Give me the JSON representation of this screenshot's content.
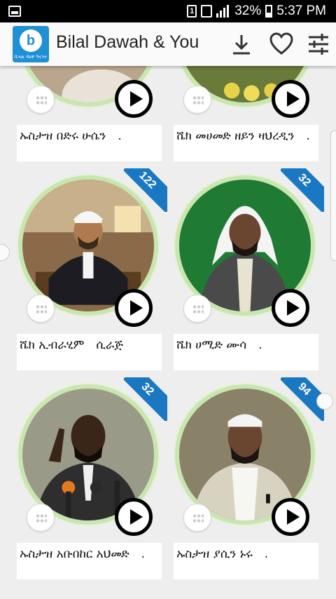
{
  "status_bar": {
    "sim_badge": "1",
    "battery": "32%",
    "time": "5:37 PM"
  },
  "app_bar": {
    "title": "Bilal Dawah & You",
    "logo_letter": "b",
    "logo_caption": "ቢላል ዳዕዋ ካናንተ",
    "icons": [
      "download-icon",
      "heart-icon",
      "filter-icon"
    ]
  },
  "colors": {
    "accent": "#1a78c2",
    "ring": "#c9e6b0",
    "logo_bg": "#1f8fd6"
  },
  "items": [
    {
      "name": "ኡስታዝ በድሩ ሁሴን　.",
      "count": null
    },
    {
      "name": "ሼክ መሀመድ ዘይን ዛህረዲን　.",
      "count": null
    },
    {
      "name": "ሼክ ኢብራሂም　ሲራጅ",
      "count": "122"
    },
    {
      "name": "ሼክ ሀሚድ ሙሳ　.",
      "count": "32"
    },
    {
      "name": "ኡስታዝ አቡበከር አህመድ　.",
      "count": "32"
    },
    {
      "name": "ኡስታዝ ያሲን ኑሩ　.",
      "count": "94"
    }
  ]
}
